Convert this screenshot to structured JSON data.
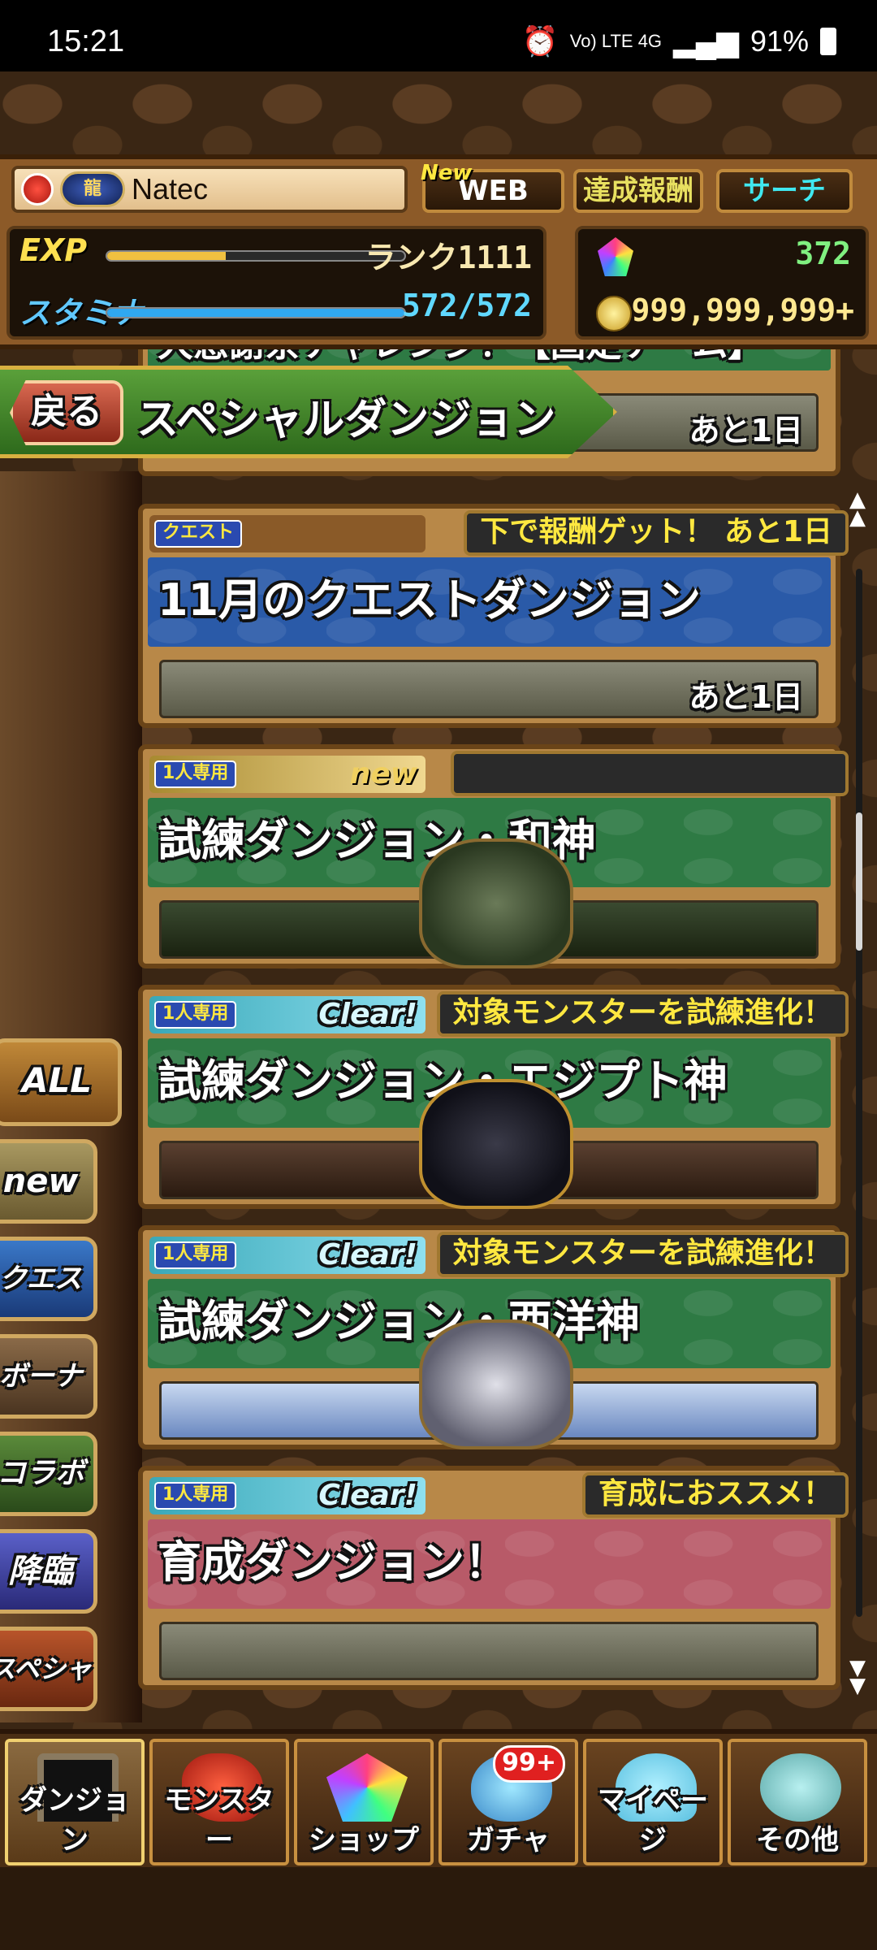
{
  "status_bar": {
    "time": "15:21",
    "network": "Vo) LTE 4G",
    "battery": "91%"
  },
  "header": {
    "player_name": "Natec",
    "rank_badge_text": "龍",
    "web_new_tag": "New",
    "web_button": "WEB",
    "reward_button": "達成報酬",
    "search_button": "サーチ",
    "exp_label": "EXP",
    "exp_progress": 0.4,
    "rank_text": "ランク1111",
    "stamina_label": "スタミナ",
    "stamina_value": "572/572",
    "stamina_progress": 1.0,
    "magic_stones": "372",
    "coins": "999,999,999+"
  },
  "title_banner": {
    "back_label": "戻る",
    "title": "スペシャルダンジョン"
  },
  "dungeon_list": {
    "partial_top": {
      "title": "大感謝祭チャレンジ！【固定チーム】",
      "days_left": "あと1日"
    },
    "cards": [
      {
        "tag": "クエスト",
        "status": "",
        "notice": "下で報酬ゲット！ あと1日",
        "title": "11月のクエストダンジョン",
        "days_left": "あと1日"
      },
      {
        "tag": "1人専用",
        "status": "new",
        "notice": "",
        "title": "試練ダンジョン・和神",
        "days_left": ""
      },
      {
        "tag": "1人専用",
        "status": "Clear!",
        "notice": "対象モンスターを試練進化！",
        "title": "試練ダンジョン・エジプト神",
        "days_left": ""
      },
      {
        "tag": "1人専用",
        "status": "Clear!",
        "notice": "対象モンスターを試練進化！",
        "title": "試練ダンジョン・西洋神",
        "days_left": ""
      },
      {
        "tag": "1人専用",
        "status": "Clear!",
        "notice": "育成におススメ！",
        "title": "育成ダンジョン！",
        "days_left": ""
      }
    ]
  },
  "category_tabs": {
    "all": "ALL",
    "new": "new",
    "quest": "クエスト",
    "bonus": "ボーナス",
    "collab": "コラボ",
    "descend": "降臨",
    "special": "スペシャル"
  },
  "bottom_nav": {
    "dungeon": "ダンジョン",
    "monster": "モンスター",
    "shop": "ショップ",
    "gacha": "ガチャ",
    "gacha_badge": "99+",
    "mypage": "マイページ",
    "other": "その他"
  },
  "colors": {
    "exp_fill": "#f0c040",
    "stamina_fill": "#30a8f0",
    "notice_text": "#ffe840"
  }
}
